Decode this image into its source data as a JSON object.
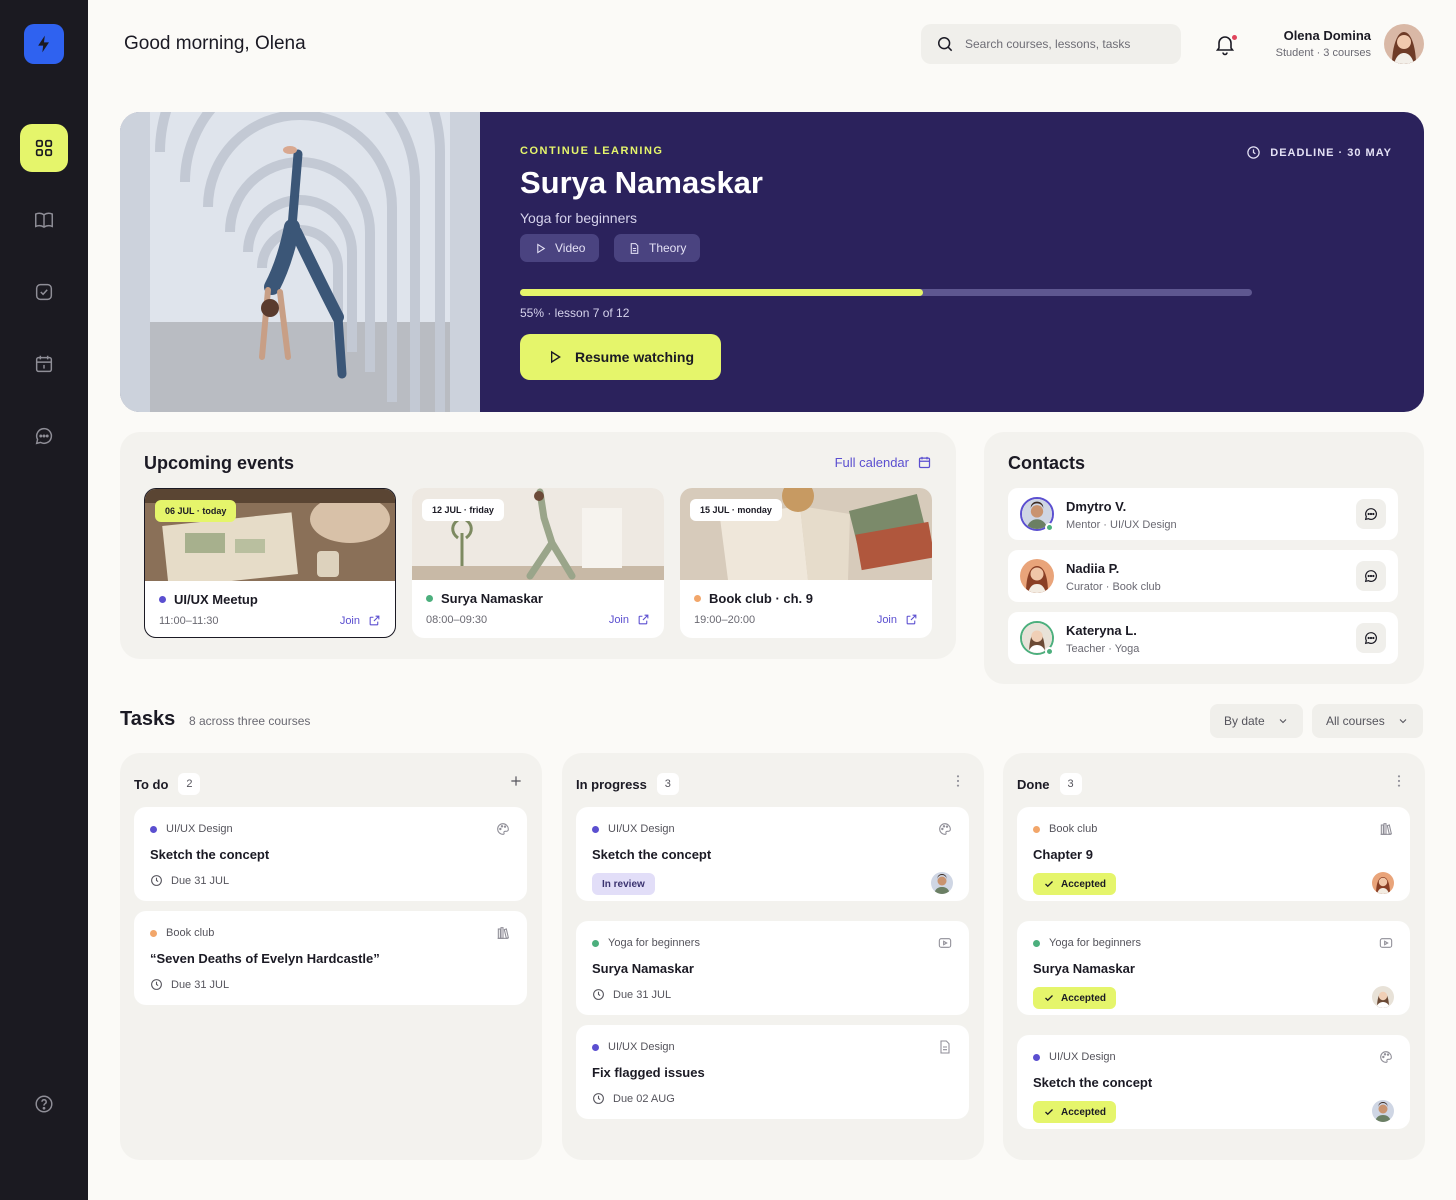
{
  "header": {
    "greeting": "Good morning, Olena",
    "search_placeholder": "Search courses, lessons, tasks",
    "user_name": "Olena Domina",
    "user_sub": "Student · 3 courses"
  },
  "hero": {
    "kicker": "CONTINUE LEARNING",
    "title": "Surya Namaskar",
    "subtitle": "Yoga for beginners",
    "chips": [
      "Video",
      "Theory"
    ],
    "deadline": "DEADLINE · 30 MAY",
    "progress": 0.55,
    "progress_text": "55% · lesson 7 of 12",
    "resume_label": "Resume watching"
  },
  "events": {
    "title": "Upcoming events",
    "full_calendar": "Full calendar",
    "items": [
      {
        "date": "06 JUL · today",
        "title": "UI/UX Meetup",
        "time": "11:00–11:30",
        "join": "Join",
        "color": "#5b4fd0"
      },
      {
        "date": "12 JUL · friday",
        "title": "Surya Namaskar",
        "time": "08:00–09:30",
        "join": "Join",
        "color": "#4caf7d"
      },
      {
        "date": "15 JUL · monday",
        "title": "Book club · ch. 9",
        "time": "19:00–20:00",
        "join": "Join",
        "color": "#f2a66a"
      }
    ]
  },
  "contacts": {
    "title": "Contacts",
    "items": [
      {
        "name": "Dmytro V.",
        "role": "Mentor · UI/UX Design"
      },
      {
        "name": "Nadiia P.",
        "role": "Curator · Book club"
      },
      {
        "name": "Kateryna L.",
        "role": "Teacher · Yoga"
      }
    ]
  },
  "tasks": {
    "title": "Tasks",
    "subtitle": "8 across three courses",
    "filter_sort": "By date",
    "filter_course": "All courses",
    "columns": [
      {
        "name": "To do",
        "count": "2",
        "cards": [
          {
            "course": "UI/UX Design",
            "title": "Sketch the concept",
            "due": "Due 31 JUL"
          },
          {
            "course": "Book club",
            "title": "“Seven Deaths of Evelyn Hardcastle”",
            "due": "Due 31 JUL"
          }
        ]
      },
      {
        "name": "In progress",
        "count": "3",
        "cards": [
          {
            "course": "UI/UX Design",
            "title": "Sketch the concept",
            "badge": "In review"
          },
          {
            "course": "Yoga for beginners",
            "title": "Surya Namaskar",
            "due": "Due 31 JUL"
          },
          {
            "course": "UI/UX Design",
            "title": "Fix flagged issues",
            "due": "Due 02 AUG"
          }
        ]
      },
      {
        "name": "Done",
        "count": "3",
        "cards": [
          {
            "course": "Book club",
            "title": "Chapter 9",
            "badge": "Accepted"
          },
          {
            "course": "Yoga for beginners",
            "title": "Surya Namaskar",
            "badge": "Accepted"
          },
          {
            "course": "UI/UX Design",
            "title": "Sketch the concept",
            "badge": "Accepted"
          }
        ]
      }
    ]
  },
  "colors": {
    "accent": "#e5f56b",
    "hero_bg": "#2b225c",
    "link": "#5b4fd0",
    "uiux": "#5b4fd0",
    "yoga": "#4caf7d",
    "bookclub": "#f2a66a"
  }
}
